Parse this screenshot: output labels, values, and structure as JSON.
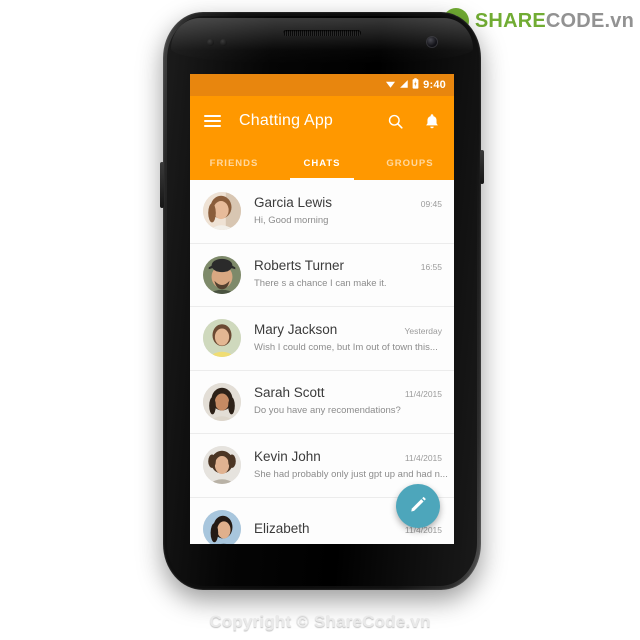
{
  "watermark": {
    "logo_icon": "sharecode-recycle-logo-icon",
    "brand_primary": "SHARE",
    "brand_secondary": "CODE.vn",
    "brand_primary_color": "#6aa829",
    "brand_secondary_color": "#8d8d8d",
    "copyright": "Copyright © ShareCode.vn"
  },
  "device": {
    "name": "android-phone-mockup",
    "frame_color": "#0b0b0b"
  },
  "statusbar": {
    "time": "9:40",
    "wifi_icon": "wifi-icon",
    "signal_icon": "cellular-signal-icon",
    "battery_icon": "battery-icon",
    "background": "#e8860e"
  },
  "toolbar": {
    "menu_icon": "hamburger-menu-icon",
    "title": "Chatting App",
    "search_icon": "search-icon",
    "notification_icon": "bell-icon",
    "background": "#ff9800"
  },
  "tabs": {
    "items": [
      {
        "label": "FRIENDS",
        "active": false
      },
      {
        "label": "CHATS",
        "active": true
      },
      {
        "label": "GROUPS",
        "active": false
      }
    ]
  },
  "chat_list": [
    {
      "name": "Garcia Lewis",
      "message": "Hi, Good morning",
      "time": "09:45",
      "avatar": "avatar-woman-light-hair",
      "avatar_bg": "#efe2d4",
      "skin": "#e7bb9a",
      "hair": "#8a5d3b",
      "cloth": "#f2efe9"
    },
    {
      "name": "Roberts Turner",
      "message": "There s a chance I can make it.",
      "time": "16:55",
      "avatar": "avatar-man-with-cap",
      "avatar_bg": "#7e8a6a",
      "skin": "#d9a882",
      "hair": "#2b2b2b",
      "cloth": "#4a5340"
    },
    {
      "name": "Mary Jackson",
      "message": "Wish I could come, but Im out of town this...",
      "time": "Yesterday",
      "avatar": "avatar-woman-yellow-top",
      "avatar_bg": "#cfd9bd",
      "skin": "#e3b793",
      "hair": "#6b4a33",
      "cloth": "#f0dd73"
    },
    {
      "name": "Sarah Scott",
      "message": "Do you have any recomendations?",
      "time": "11/4/2015",
      "avatar": "avatar-woman-dark-hair",
      "avatar_bg": "#e3ded6",
      "skin": "#c58a63",
      "hair": "#2d2118",
      "cloth": "#ddd6cb"
    },
    {
      "name": "Kevin John",
      "message": "She had probably only just gpt up and had n...",
      "time": "11/4/2015",
      "avatar": "avatar-man-curly-hair",
      "avatar_bg": "#e6e3de",
      "skin": "#e0b291",
      "hair": "#4b3524",
      "cloth": "#b9b2a6"
    },
    {
      "name": "Elizabeth",
      "message": "",
      "time": "11/4/2015",
      "avatar": "avatar-woman-blue-bg",
      "avatar_bg": "#a8c6dd",
      "skin": "#e0b08c",
      "hair": "#241a14",
      "cloth": "#2f3a46"
    }
  ],
  "fab": {
    "icon": "pencil-compose-icon",
    "color": "#4da6bb"
  }
}
